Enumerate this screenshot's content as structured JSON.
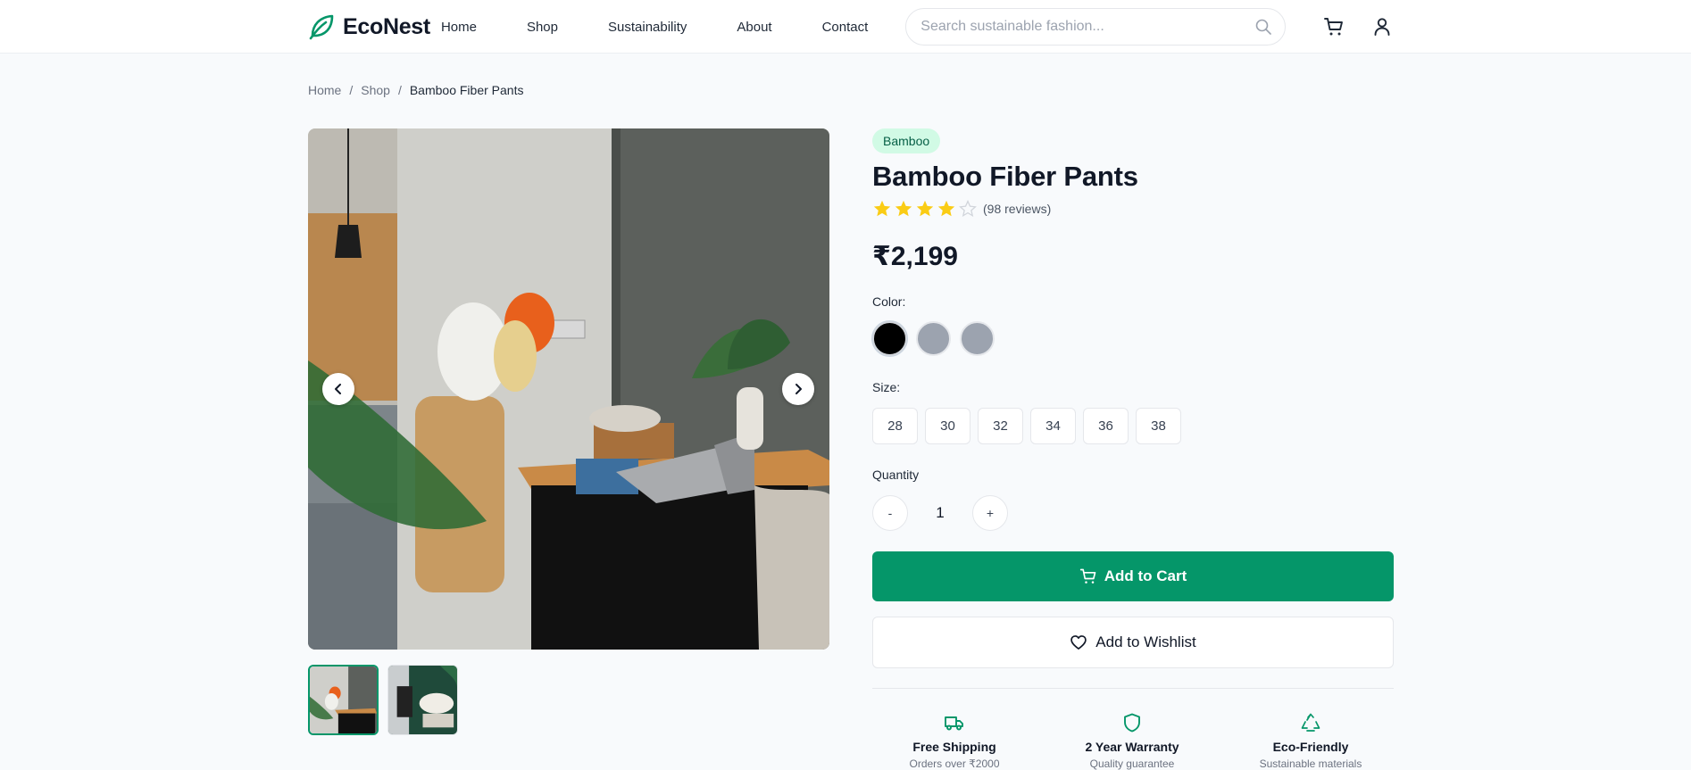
{
  "header": {
    "logo_text": "EcoNest",
    "nav": [
      "Home",
      "Shop",
      "Sustainability",
      "About",
      "Contact"
    ],
    "search_placeholder": "Search sustainable fashion...",
    "icons": [
      "search-icon",
      "cart-icon",
      "user-icon"
    ]
  },
  "breadcrumb": {
    "items": [
      "Home",
      "Shop",
      "Bamboo Fiber Pants"
    ],
    "separator": "/"
  },
  "gallery": {
    "thumbnails": 2,
    "selected_thumbnail": 1
  },
  "product": {
    "badge": "Bamboo",
    "title": "Bamboo Fiber Pants",
    "rating": 4,
    "rating_max": 5,
    "reviews_text": "(98 reviews)",
    "price": "₹2,199",
    "color_label": "Color:",
    "colors": [
      "#000000",
      "#9ca3af",
      "#9ca3af"
    ],
    "size_label": "Size:",
    "sizes": [
      "28",
      "30",
      "32",
      "34",
      "36",
      "38"
    ],
    "quantity_label": "Quantity",
    "quantity": "1",
    "minus": "-",
    "plus": "+",
    "add_to_cart": "Add to Cart",
    "add_to_wishlist": "Add to Wishlist"
  },
  "features": [
    {
      "icon": "truck-icon",
      "title": "Free Shipping",
      "subtitle": "Orders over ₹2000"
    },
    {
      "icon": "shield-icon",
      "title": "2 Year Warranty",
      "subtitle": "Quality guarantee"
    },
    {
      "icon": "recycle-icon",
      "title": "Eco-Friendly",
      "subtitle": "Sustainable materials"
    }
  ],
  "colors": {
    "accent": "#059669",
    "badge_bg": "#d1fae5",
    "star": "#facc15"
  }
}
